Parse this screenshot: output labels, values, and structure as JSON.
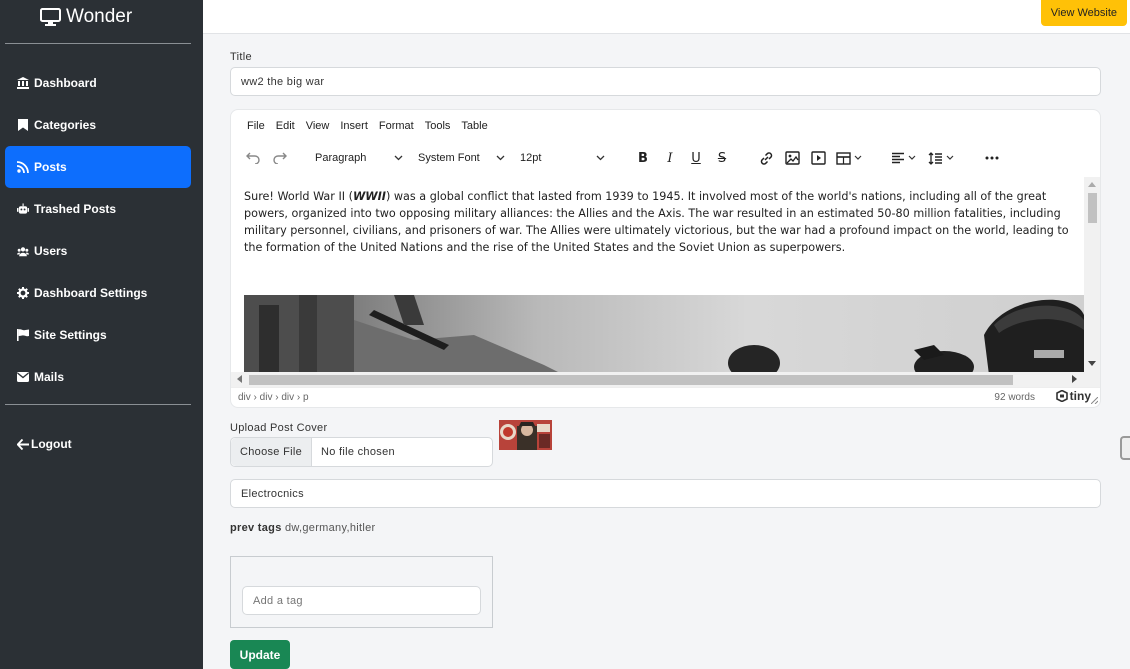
{
  "brand": {
    "name": "Wonder",
    "icon": "monitor-icon"
  },
  "sidebar": {
    "items": [
      {
        "label": "Dashboard",
        "icon": "bank-icon"
      },
      {
        "label": "Categories",
        "icon": "bookmark-icon"
      },
      {
        "label": "Posts",
        "icon": "rss-icon",
        "active": true
      },
      {
        "label": "Trashed Posts",
        "icon": "robot-icon"
      },
      {
        "label": "Users",
        "icon": "users-icon"
      },
      {
        "label": "Dashboard Settings",
        "icon": "gear-icon"
      },
      {
        "label": "Site Settings",
        "icon": "flag-icon"
      },
      {
        "label": "Mails",
        "icon": "envelope-icon"
      }
    ],
    "logout": {
      "label": "Logout",
      "icon": "arrow-left-icon"
    }
  },
  "topbar": {
    "view_website": "View Website"
  },
  "form": {
    "title_label": "Title",
    "title_value": "ww2 the big war",
    "editor": {
      "menu": [
        "File",
        "Edit",
        "View",
        "Insert",
        "Format",
        "Tools",
        "Table"
      ],
      "block_format": "Paragraph",
      "font_family": "System Font",
      "font_size": "12pt",
      "content_before": "Sure! World War II (",
      "content_emphasis": "WWII",
      "content_after": ") was a global conflict that lasted from 1939 to 1945. It involved most of the world's nations, including all of the great powers, organized into two opposing military alliances: the Allies and the Axis. The war resulted in an estimated 50-80 million fatalities, including military personnel, civilians, and prisoners of war. The Allies were ultimately victorious, but the war had a profound impact on the world, leading to the formation of the United Nations and the rise of the United States and the Soviet Union as superpowers.",
      "path": "div › div › div › p",
      "word_count": "92 words",
      "branding": "tiny"
    },
    "upload_label": "Upload Post Cover",
    "choose_file": "Choose File",
    "no_file": "No file chosen",
    "category_value": "Electrocnics",
    "prev_tags_label": "prev tags",
    "prev_tags_value": "dw,germany,hitler",
    "tag_placeholder": "Add a tag",
    "update_label": "Update"
  },
  "colors": {
    "sidebar": "#2b3035",
    "active": "#0d6efd",
    "view_button": "#ffc107",
    "update_button": "#198754"
  }
}
